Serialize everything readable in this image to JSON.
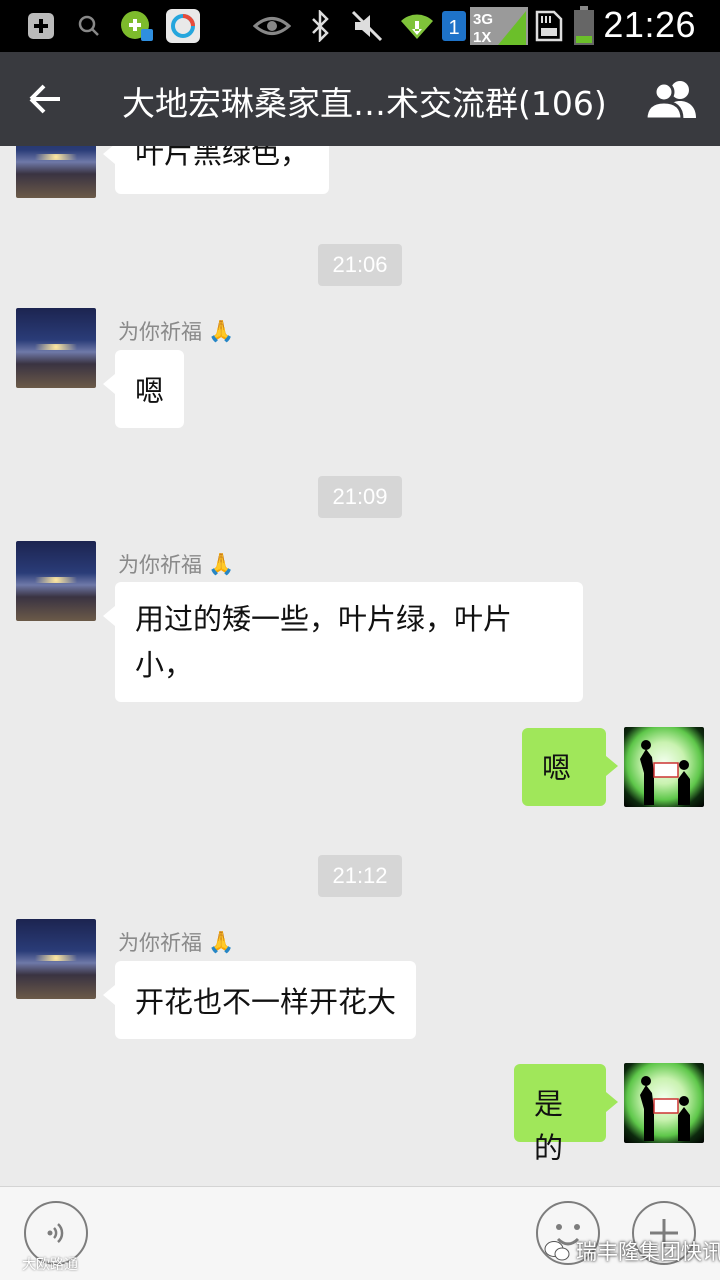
{
  "status_bar": {
    "time": "21:26",
    "network": "3G",
    "network_alt": "1X",
    "sim": "1",
    "icons": [
      "add-icon",
      "search-icon",
      "game-icon",
      "sync-icon",
      "eye-icon",
      "bluetooth-icon",
      "mute-icon",
      "wifi-icon",
      "sim-icon",
      "signal-icon",
      "sd-card-icon",
      "battery-icon"
    ]
  },
  "header": {
    "back_icon": "back-arrow-icon",
    "title": "大地宏琳桑家直…术交流群(106)",
    "members_icon": "group-members-icon"
  },
  "messages": [
    {
      "type": "incoming",
      "text": "叶片黑绿色，"
    },
    {
      "type": "time",
      "text": "21:06"
    },
    {
      "type": "incoming",
      "sender": "为你祈福",
      "sender_emoji": "🙏",
      "text": "嗯"
    },
    {
      "type": "time",
      "text": "21:09"
    },
    {
      "type": "incoming",
      "sender": "为你祈福",
      "sender_emoji": "🙏",
      "text_line1": "用过的矮一些，叶片绿，叶片",
      "text_line2": "小，"
    },
    {
      "type": "outgoing",
      "text": "嗯"
    },
    {
      "type": "time",
      "text": "21:12"
    },
    {
      "type": "incoming",
      "sender": "为你祈福",
      "sender_emoji": "🙏",
      "text": "开花也不一样开花大"
    },
    {
      "type": "outgoing",
      "text": "是的"
    }
  ],
  "input_bar": {
    "voice_icon": "voice-icon",
    "emoji_icon": "emoji-icon",
    "plus_icon": "plus-icon"
  },
  "watermarks": {
    "right": "瑞丰隆集团快讯",
    "left": "大欧路通"
  },
  "colors": {
    "title_bar": "#393a3f",
    "chat_bg": "#ebebeb",
    "outgoing_bubble": "#a0e75a",
    "incoming_bubble": "#ffffff",
    "timestamp_bg": "#d6d6d6"
  }
}
